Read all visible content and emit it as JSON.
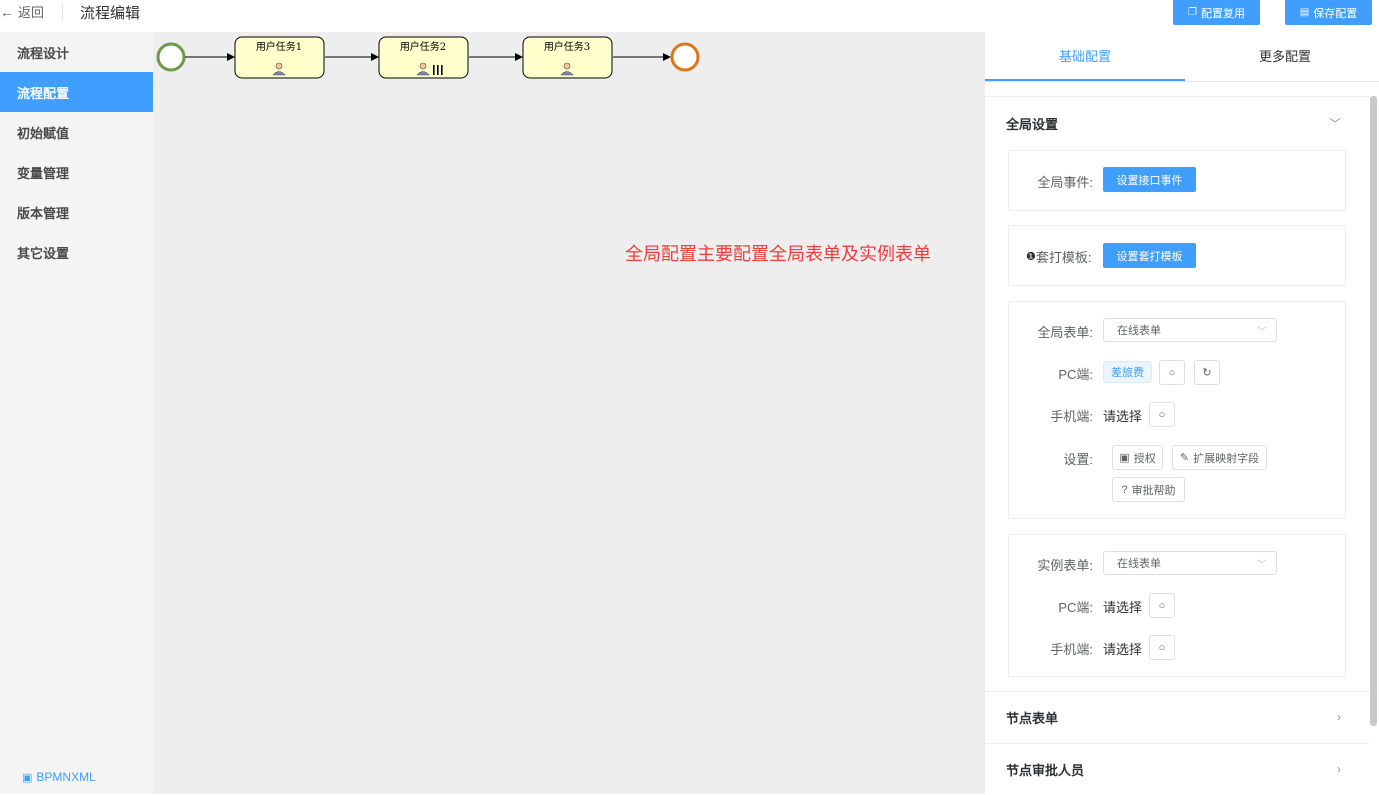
{
  "header": {
    "back_label": "返回",
    "title": "流程编辑",
    "copy_config_label": "配置复用",
    "save_config_label": "保存配置"
  },
  "sidebar": {
    "items": [
      {
        "label": "流程设计",
        "active": false
      },
      {
        "label": "流程配置",
        "active": true
      },
      {
        "label": "初始赋值",
        "active": false
      },
      {
        "label": "变量管理",
        "active": false
      },
      {
        "label": "版本管理",
        "active": false
      },
      {
        "label": "其它设置",
        "active": false
      }
    ],
    "bpmn_link": "BPMNXML"
  },
  "canvas": {
    "tasks": [
      "用户任务1",
      "用户任务2",
      "用户任务3"
    ],
    "annotation": "全局配置主要配置全局表单及实例表单"
  },
  "panel": {
    "tabs": [
      "基础配置",
      "更多配置"
    ],
    "global": {
      "title": "全局设置",
      "event_label": "全局事件:",
      "event_button": "设置接口事件",
      "print_label": "套打模板:",
      "print_button": "设置套打模板",
      "form_label": "全局表单:",
      "form_select": "在线表单",
      "pc_label": "PC端:",
      "pc_tag": "差旅费",
      "mobile_label": "手机端:",
      "mobile_value": "请选择",
      "settings_label": "设置:",
      "auth_button": "授权",
      "extend_button": "扩展映射字段",
      "help_button": "审批帮助"
    },
    "instance": {
      "form_label": "实例表单:",
      "form_select": "在线表单",
      "pc_label": "PC端:",
      "pc_value": "请选择",
      "mobile_label": "手机端:",
      "mobile_value": "请选择"
    },
    "node_form_title": "节点表单",
    "node_approver_title": "节点审批人员"
  },
  "colors": {
    "primary": "#409eff",
    "annotation": "#f03c3c",
    "start_event": "#6a9a4a",
    "end_event": "#e0741c",
    "task_fill": "#ffffcc"
  }
}
